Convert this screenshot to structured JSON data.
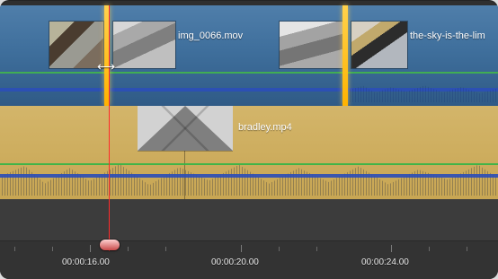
{
  "timeline": {
    "top_track": {
      "clip_names": [
        "img_0066.mov",
        "the-sky-is-the-lim"
      ]
    },
    "bottom_track": {
      "clip_name": "bradley.mp4"
    },
    "ruler": {
      "labels": [
        "00:00:16.00",
        "00:00:20.00",
        "00:00:24.00"
      ]
    }
  },
  "colors": {
    "video_track_blue": "#355f86",
    "av_track_gold": "#c9a85a",
    "playhead_red": "#ff2b2b",
    "highlight_yellow": "#ffd24d",
    "waveform_green": "#43b54d",
    "waveform_blue": "#2b4fb8"
  },
  "icons": {
    "trim_cursor": "trim-resize-cursor-icon"
  }
}
